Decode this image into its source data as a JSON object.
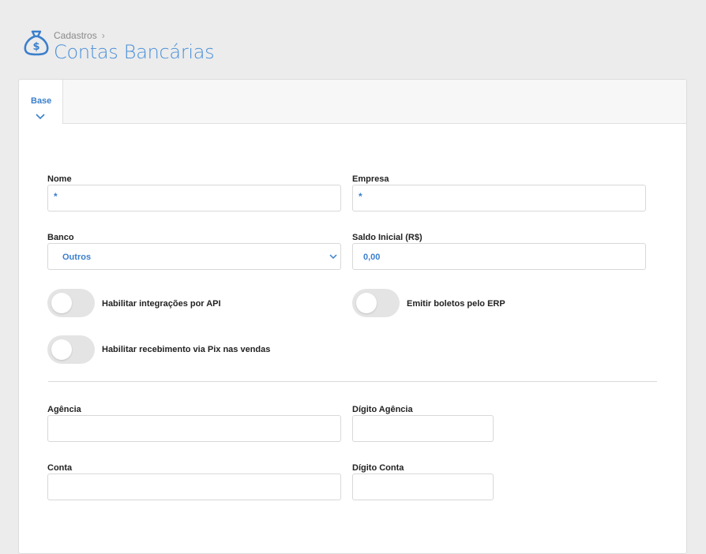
{
  "header": {
    "breadcrumb": "Cadastros",
    "breadcrumb_sep": "›",
    "title": "Contas Bancárias",
    "icon": "money-bag-icon"
  },
  "tabs": [
    {
      "label": "Base",
      "active": true
    }
  ],
  "form": {
    "nome": {
      "label": "Nome",
      "value": "*"
    },
    "empresa": {
      "label": "Empresa",
      "value": "*"
    },
    "banco": {
      "label": "Banco",
      "value": "Outros"
    },
    "saldo_inicial": {
      "label": "Saldo Inicial (R$)",
      "value": "0,00"
    },
    "toggles": {
      "api": {
        "label": "Habilitar integrações por API",
        "on": false
      },
      "boletos": {
        "label": "Emitir boletos pelo ERP",
        "on": false
      },
      "pix": {
        "label": "Habilitar recebimento via Pix nas vendas",
        "on": false
      }
    },
    "agencia": {
      "label": "Agência",
      "value": ""
    },
    "digito_agencia": {
      "label": "Dígito Agência",
      "value": ""
    },
    "conta": {
      "label": "Conta",
      "value": ""
    },
    "digito_conta": {
      "label": "Dígito Conta",
      "value": ""
    }
  },
  "colors": {
    "accent": "#3a7fcc",
    "title": "#4a90d9",
    "toggle_off": "#e4e4e4"
  }
}
